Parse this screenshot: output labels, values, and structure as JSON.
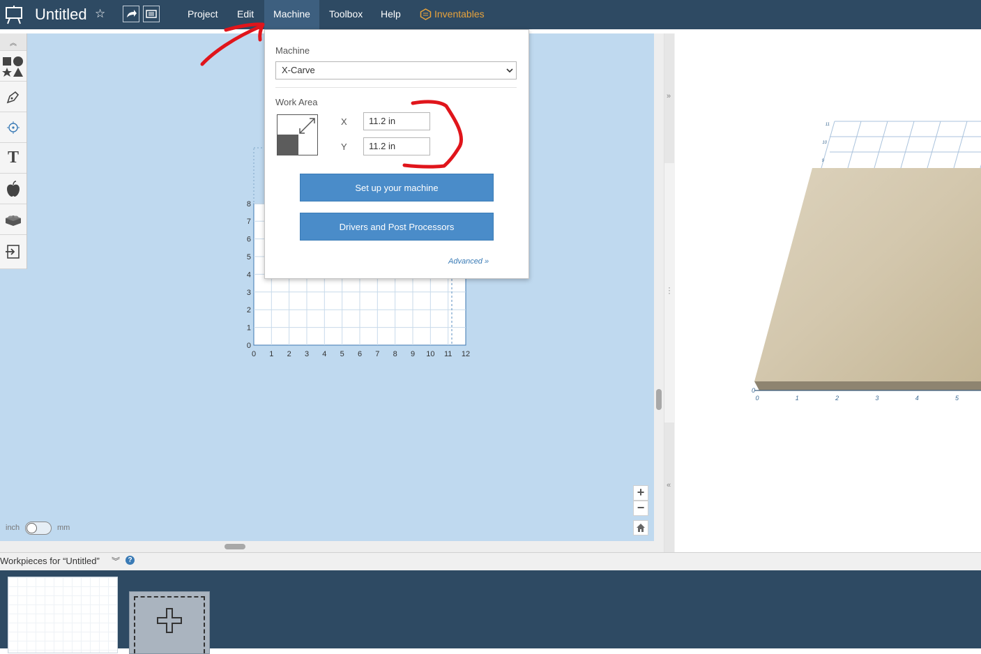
{
  "app": {
    "title": "Untitled"
  },
  "menu": {
    "project": "Project",
    "edit": "Edit",
    "machine": "Machine",
    "toolbox": "Toolbox",
    "help": "Help",
    "inventables": "Inventables"
  },
  "machine_panel": {
    "machine_label": "Machine",
    "machine_selected": "X-Carve",
    "work_area_label": "Work Area",
    "x_label": "X",
    "x_value": "11.2 in",
    "y_label": "Y",
    "y_value": "11.2 in",
    "setup_button": "Set up your machine",
    "drivers_button": "Drivers and Post Processors",
    "advanced_link": "Advanced »"
  },
  "grid": {
    "x_ticks": [
      "0",
      "1",
      "2",
      "3",
      "4",
      "5",
      "6",
      "7",
      "8",
      "9",
      "10",
      "11",
      "12"
    ],
    "y_ticks": [
      "0",
      "1",
      "2",
      "3",
      "4",
      "5",
      "6",
      "7",
      "8"
    ]
  },
  "preview": {
    "x_ticks": [
      "0",
      "1",
      "2",
      "3",
      "4",
      "5"
    ],
    "y_origin": "0",
    "back_ticks": [
      "11",
      "10",
      "9"
    ]
  },
  "units": {
    "inch": "inch",
    "mm": "mm",
    "selected": "inch"
  },
  "workpieces": {
    "title": "Workpieces for “Untitled”"
  },
  "colors": {
    "topbar": "#2e4a63",
    "canvas": "#bfd9ef",
    "accent": "#4a8cc9",
    "inventables": "#e8a33c",
    "annotation": "#e0151b"
  }
}
